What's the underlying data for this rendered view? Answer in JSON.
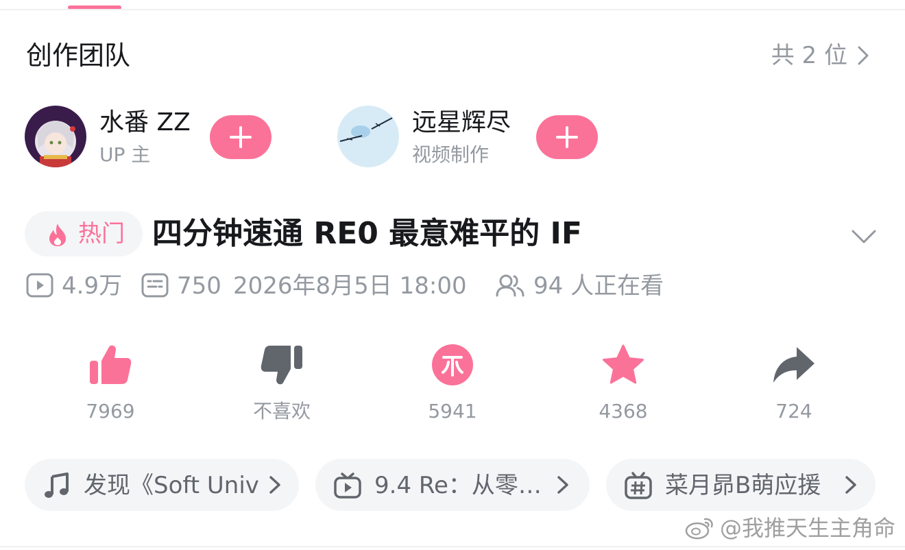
{
  "team": {
    "title": "创作团队",
    "count": "共 2 位"
  },
  "creators": [
    {
      "name": "水番 ZZ",
      "role": "UP 主"
    },
    {
      "name": "远星辉尽",
      "role": "视频制作"
    }
  ],
  "video": {
    "badge": "热门",
    "title": "四分钟速通 RE0 最意难平的 IF"
  },
  "stats": {
    "plays": "4.9万",
    "danmaku": "750",
    "date": "2026年8月5日 18:00",
    "watching": "94 人正在看"
  },
  "actions": [
    {
      "name": "like",
      "label": "7969"
    },
    {
      "name": "dislike",
      "label": "不喜欢"
    },
    {
      "name": "coin",
      "label": "5941"
    },
    {
      "name": "favorite",
      "label": "4368"
    },
    {
      "name": "share",
      "label": "724"
    }
  ],
  "chips": [
    {
      "icon": "music-note-icon",
      "label": "发现《Soft Univ"
    },
    {
      "icon": "tv-icon",
      "label": "9.4 Re：从零…"
    },
    {
      "icon": "hashtag-icon",
      "label": "菜月昴B萌应援"
    }
  ],
  "watermark": "@我推天生主角命",
  "colors": {
    "accent": "#fb7299",
    "text_primary": "#18191c",
    "text_secondary": "#9499a0",
    "dislike_gray": "#61666d",
    "chip_bg": "#f4f5f7"
  }
}
